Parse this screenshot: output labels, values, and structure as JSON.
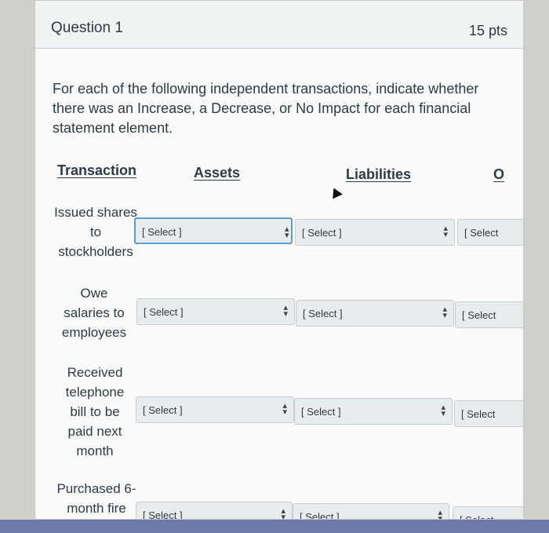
{
  "question": {
    "title": "Question 1",
    "points": "15 pts",
    "prompt": "For each of the following independent transactions, indicate whether there was an Increase, a Decrease, or No Impact for each financial statement element."
  },
  "columns": {
    "transaction": "Transaction",
    "assets": "Assets",
    "liabilities": "Liabilities",
    "third": "O"
  },
  "rows": [
    {
      "label": "Issued shares to stockholders"
    },
    {
      "label": "Owe salaries to employees"
    },
    {
      "label": "Received telephone bill to be paid next month"
    },
    {
      "label": "Purchased 6-month fire"
    }
  ],
  "select": {
    "placeholder": "[ Select ]",
    "truncated": "[ Select"
  },
  "colors": {
    "focus_border": "#5b9bd5",
    "select_bg": "#e9ecec",
    "header_bg": "#f1f2f2"
  }
}
